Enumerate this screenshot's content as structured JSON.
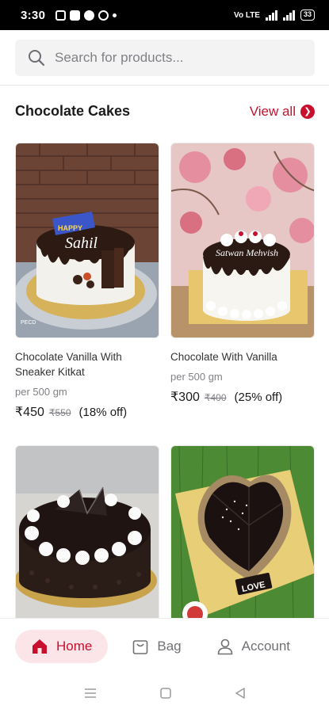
{
  "status_bar": {
    "time": "3:30",
    "network": "Vo LTE",
    "battery": "33"
  },
  "search": {
    "placeholder": "Search for products..."
  },
  "section": {
    "title": "Chocolate Cakes",
    "view_all_label": "View all"
  },
  "products": [
    {
      "name": "Chocolate Vanilla With Sneaker Kitkat",
      "unit": "per 500 gm",
      "price": "₹450",
      "mrp": "₹550",
      "discount": "(18% off)",
      "cake_text": "Sahil",
      "image_watermark": "PECD"
    },
    {
      "name": "Chocolate With Vanilla",
      "unit": "per 500 gm",
      "price": "₹300",
      "mrp": "₹400",
      "discount": "(25% off)",
      "cake_text": "Satwan Mehvish"
    },
    {
      "name": "",
      "unit": "",
      "price": "",
      "mrp": "",
      "discount": ""
    },
    {
      "name": "",
      "unit": "",
      "price": "",
      "mrp": "",
      "discount": "",
      "cake_text": "LOVE"
    }
  ],
  "bottom_nav": {
    "home_label": "Home",
    "bag_label": "Bag",
    "account_label": "Account"
  },
  "colors": {
    "accent": "#c8102e",
    "accent_light": "#fbe5e8",
    "muted": "#808186"
  },
  "icons": [
    "search-icon",
    "arrow-right-icon",
    "home-icon",
    "bag-icon",
    "account-icon",
    "menu-nav-icon",
    "square-nav-icon",
    "back-nav-icon"
  ]
}
